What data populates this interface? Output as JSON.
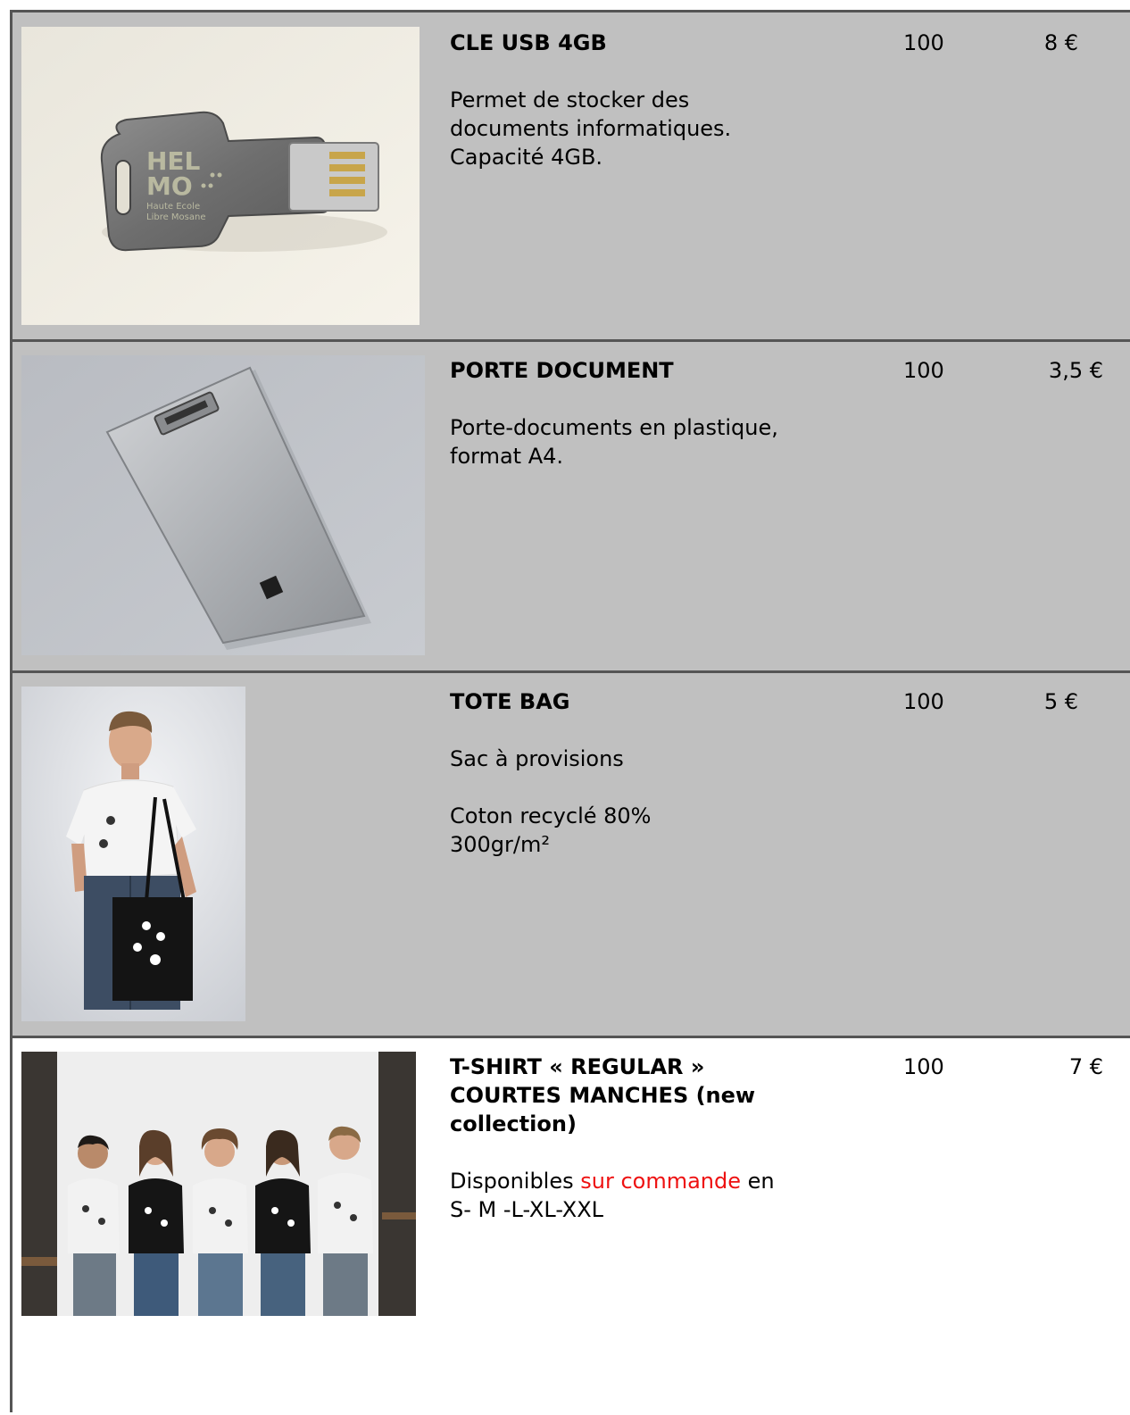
{
  "products": [
    {
      "title": "CLE USB 4GB",
      "desc_lines": [
        "Permet de stocker des",
        "documents informatiques.",
        "Capacité 4GB."
      ],
      "qty": "100",
      "price": "8 €",
      "logo_text": [
        "HEL",
        "MO",
        "Haute Ecole",
        "Libre Mosane"
      ]
    },
    {
      "title": "PORTE DOCUMENT",
      "desc_lines": [
        "Porte-documents en plastique,",
        "format A4."
      ],
      "qty": "100",
      "price": "3,5 €"
    },
    {
      "title": "TOTE BAG",
      "desc_para1": "Sac à provisions",
      "desc_lines": [
        "Coton recyclé 80%",
        "300gr/m²"
      ],
      "qty": "100",
      "price": "5 €"
    },
    {
      "title_lines": [
        "T-SHIRT « REGULAR »",
        "COURTES MANCHES (new",
        "collection)"
      ],
      "desc_start": "Disponibles ",
      "desc_highlight": "sur commande",
      "desc_end": " en",
      "desc_line2": "S- M -L-XL-XXL",
      "qty": "100",
      "price": "7 €"
    }
  ],
  "colors": {
    "row_shade": "#c0c0c0",
    "border": "#555555",
    "highlight": "#ee1111"
  }
}
